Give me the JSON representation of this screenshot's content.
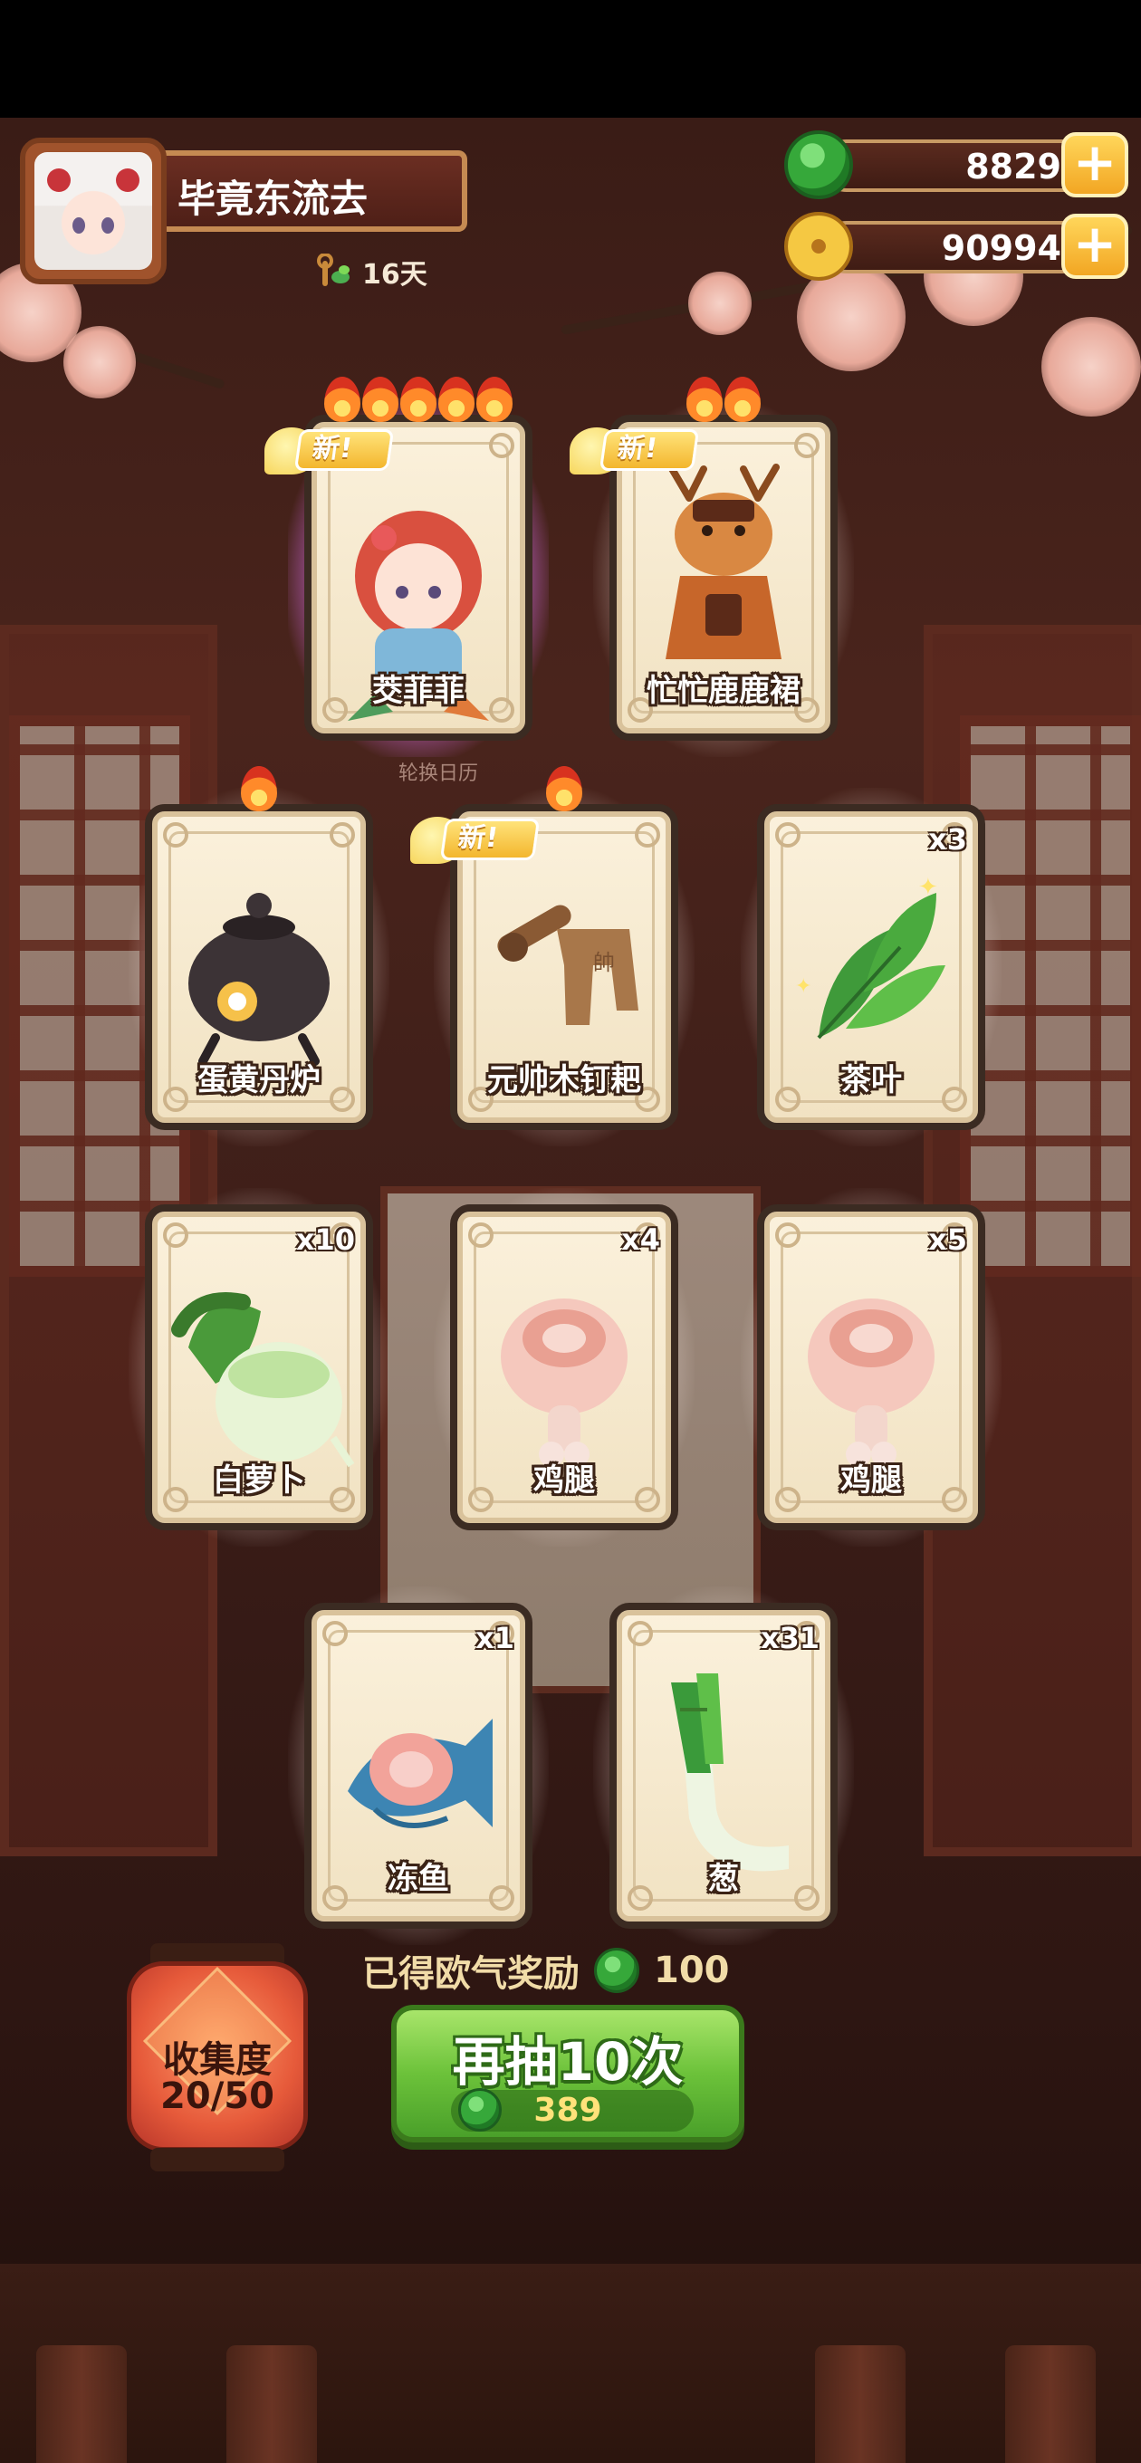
{
  "header": {
    "player_name": "毕竟东流去",
    "days": "16天",
    "jade_amount": "8829",
    "coin_amount": "90994",
    "plus_symbol": "+"
  },
  "calendar_label": "轮换日历",
  "cards": [
    {
      "id": "card-1",
      "label": "茭菲菲",
      "count": "",
      "is_new": true,
      "flames": 5,
      "art": "girl-portrait",
      "rainbow": true
    },
    {
      "id": "card-2",
      "label": "忙忙鹿鹿裙",
      "count": "",
      "is_new": true,
      "flames": 2,
      "art": "deer-dress-icon"
    },
    {
      "id": "card-3",
      "label": "蛋黄丹炉",
      "count": "",
      "is_new": false,
      "flames": 1,
      "art": "furnace-icon"
    },
    {
      "id": "card-4",
      "label": "元帅木钉耙",
      "count": "",
      "is_new": true,
      "flames": 1,
      "art": "rake-icon"
    },
    {
      "id": "card-5",
      "label": "茶叶",
      "count": "x3",
      "is_new": false,
      "flames": 0,
      "art": "tea-leaf-icon"
    },
    {
      "id": "card-6",
      "label": "白萝卜",
      "count": "x10",
      "is_new": false,
      "flames": 0,
      "art": "radish-icon"
    },
    {
      "id": "card-7",
      "label": "鸡腿",
      "count": "x4",
      "is_new": false,
      "flames": 0,
      "art": "drumstick-icon"
    },
    {
      "id": "card-8",
      "label": "鸡腿",
      "count": "x5",
      "is_new": false,
      "flames": 0,
      "art": "drumstick-icon"
    },
    {
      "id": "card-9",
      "label": "冻鱼",
      "count": "x1",
      "is_new": false,
      "flames": 0,
      "art": "fish-icon"
    },
    {
      "id": "card-10",
      "label": "葱",
      "count": "x31",
      "is_new": false,
      "flames": 0,
      "art": "scallion-icon"
    }
  ],
  "new_badge_text": "新",
  "reward": {
    "label": "已得欧气奖励",
    "value": "100"
  },
  "draw_button": {
    "label": "再抽10次",
    "cost": "389"
  },
  "collection": {
    "label": "收集度",
    "progress": "20/50"
  },
  "colors": {
    "accent_green": "#6cc23a",
    "gold": "#f3b62e",
    "card_border": "#3b2b22"
  }
}
